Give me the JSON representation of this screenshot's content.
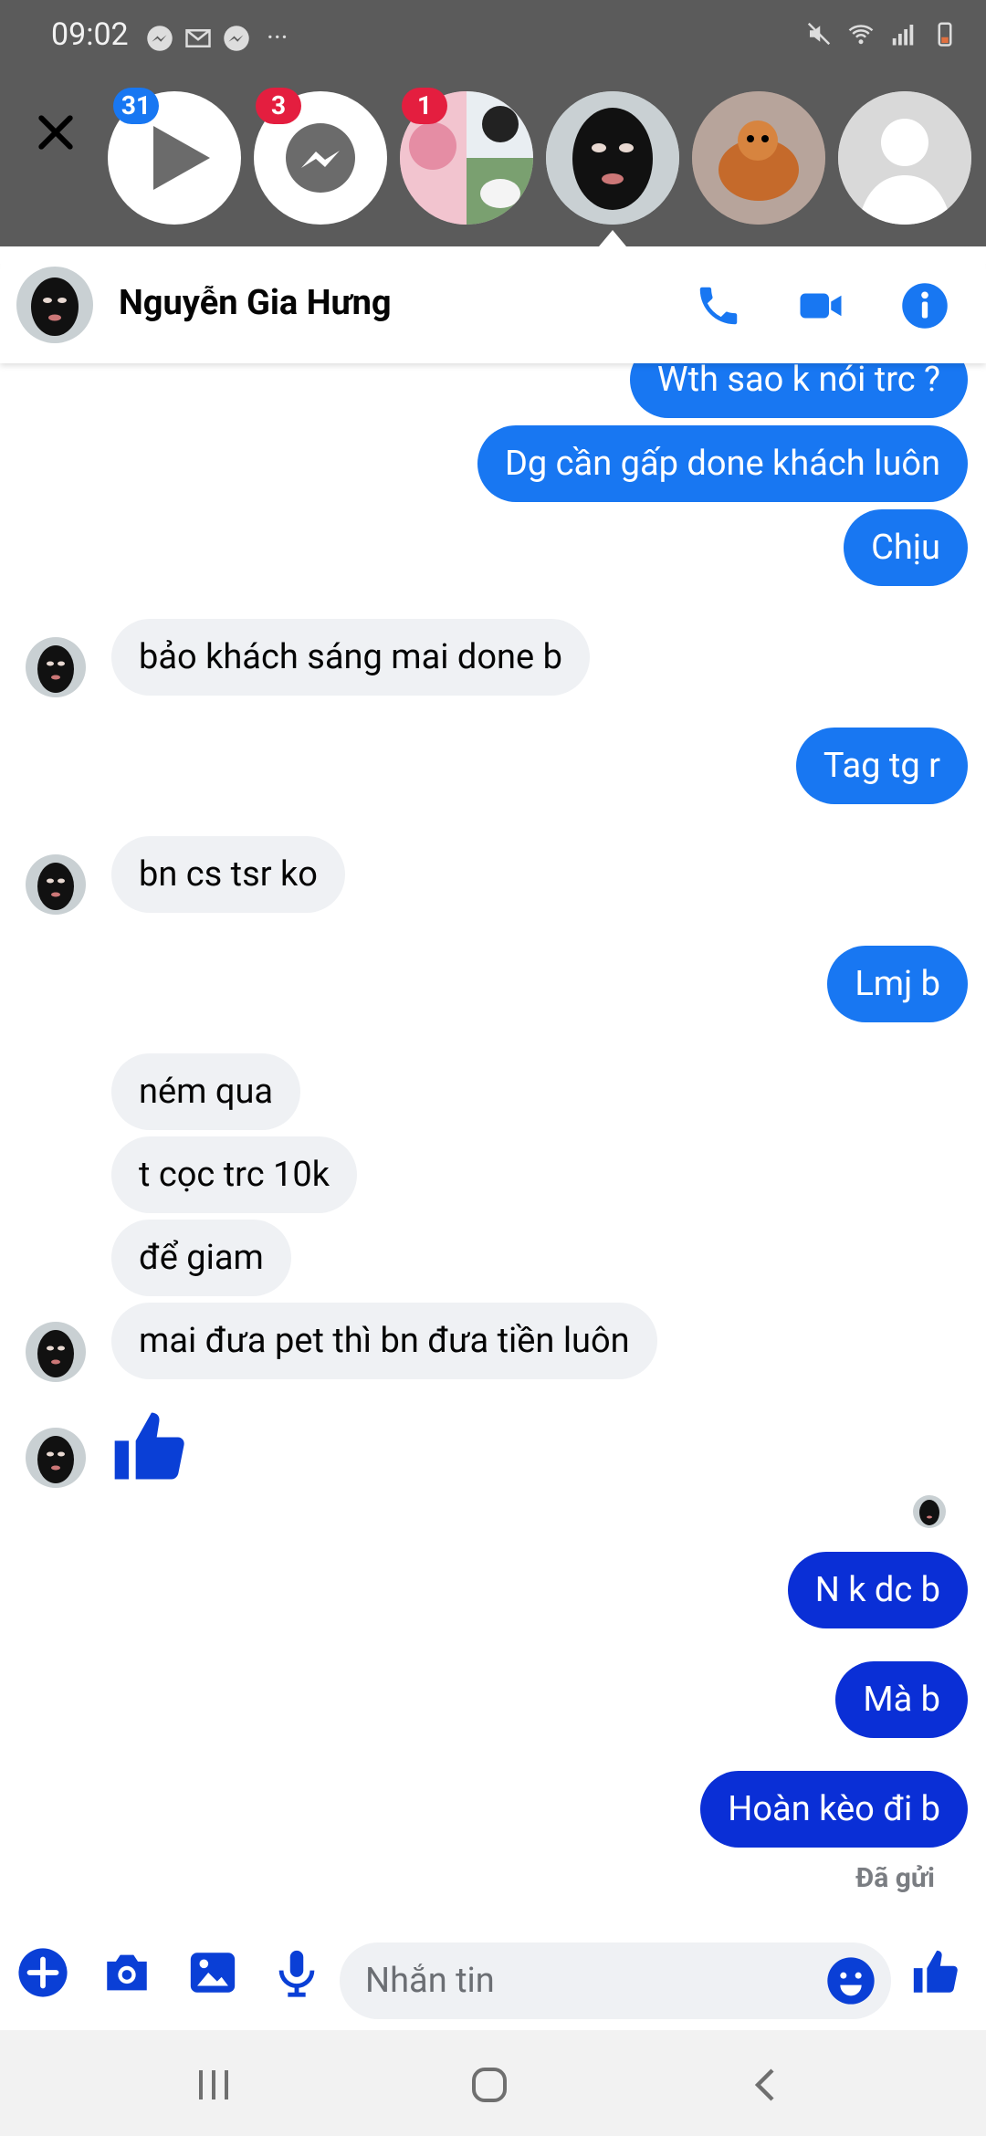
{
  "status_bar": {
    "time": "09:02",
    "more": "···"
  },
  "chat_heads": [
    {
      "name": "video",
      "badge": "31",
      "badge_color": "#1877f2"
    },
    {
      "name": "messenger",
      "badge": "3",
      "badge_color": "#e41e3f"
    },
    {
      "name": "group",
      "badge": "1",
      "badge_color": "#e41e3f"
    },
    {
      "name": "active-contact"
    },
    {
      "name": "cat-contact"
    },
    {
      "name": "unknown-contact"
    }
  ],
  "header": {
    "contact_name": "Nguyễn Gia Hưng"
  },
  "messages": [
    {
      "side": "out",
      "text": "Wth sao k nói trc ?"
    },
    {
      "side": "out",
      "text": "Dg cần gấp done khách luôn"
    },
    {
      "side": "out",
      "text": "Chịu"
    },
    {
      "side": "in",
      "text": "bảo khách sáng mai done b"
    },
    {
      "side": "out",
      "text": "Tag tg r"
    },
    {
      "side": "in",
      "text": "bn cs tsr ko"
    },
    {
      "side": "out",
      "text": "Lmj b"
    },
    {
      "side": "in",
      "text": "ném qua"
    },
    {
      "side": "in",
      "text": "t cọc trc 10k"
    },
    {
      "side": "in",
      "text": "để giam"
    },
    {
      "side": "in",
      "text": "mai đưa pet thì bn đưa tiền luôn"
    },
    {
      "side": "in",
      "text": "thumbs-up",
      "type": "like"
    },
    {
      "side": "out",
      "text": "N k dc b"
    },
    {
      "side": "out",
      "text": "Mà b"
    },
    {
      "side": "out",
      "text": "Hoàn kèo đi b"
    }
  ],
  "sent_status": "Đã gửi",
  "composer": {
    "placeholder": "Nhắn tin"
  },
  "colors": {
    "accent": "#1877f2",
    "outgoing_light": "#1877f2",
    "outgoing_dark": "#0a2fd6",
    "incoming": "#eff1f4",
    "like": "#0a3fd6"
  },
  "icons": [
    "close-icon",
    "play-icon",
    "messenger-icon",
    "phone-icon",
    "video-call-icon",
    "info-icon",
    "add-icon",
    "camera-icon",
    "gallery-icon",
    "mic-icon",
    "emoji-icon",
    "like-icon",
    "recents-icon",
    "home-icon",
    "back-icon"
  ]
}
